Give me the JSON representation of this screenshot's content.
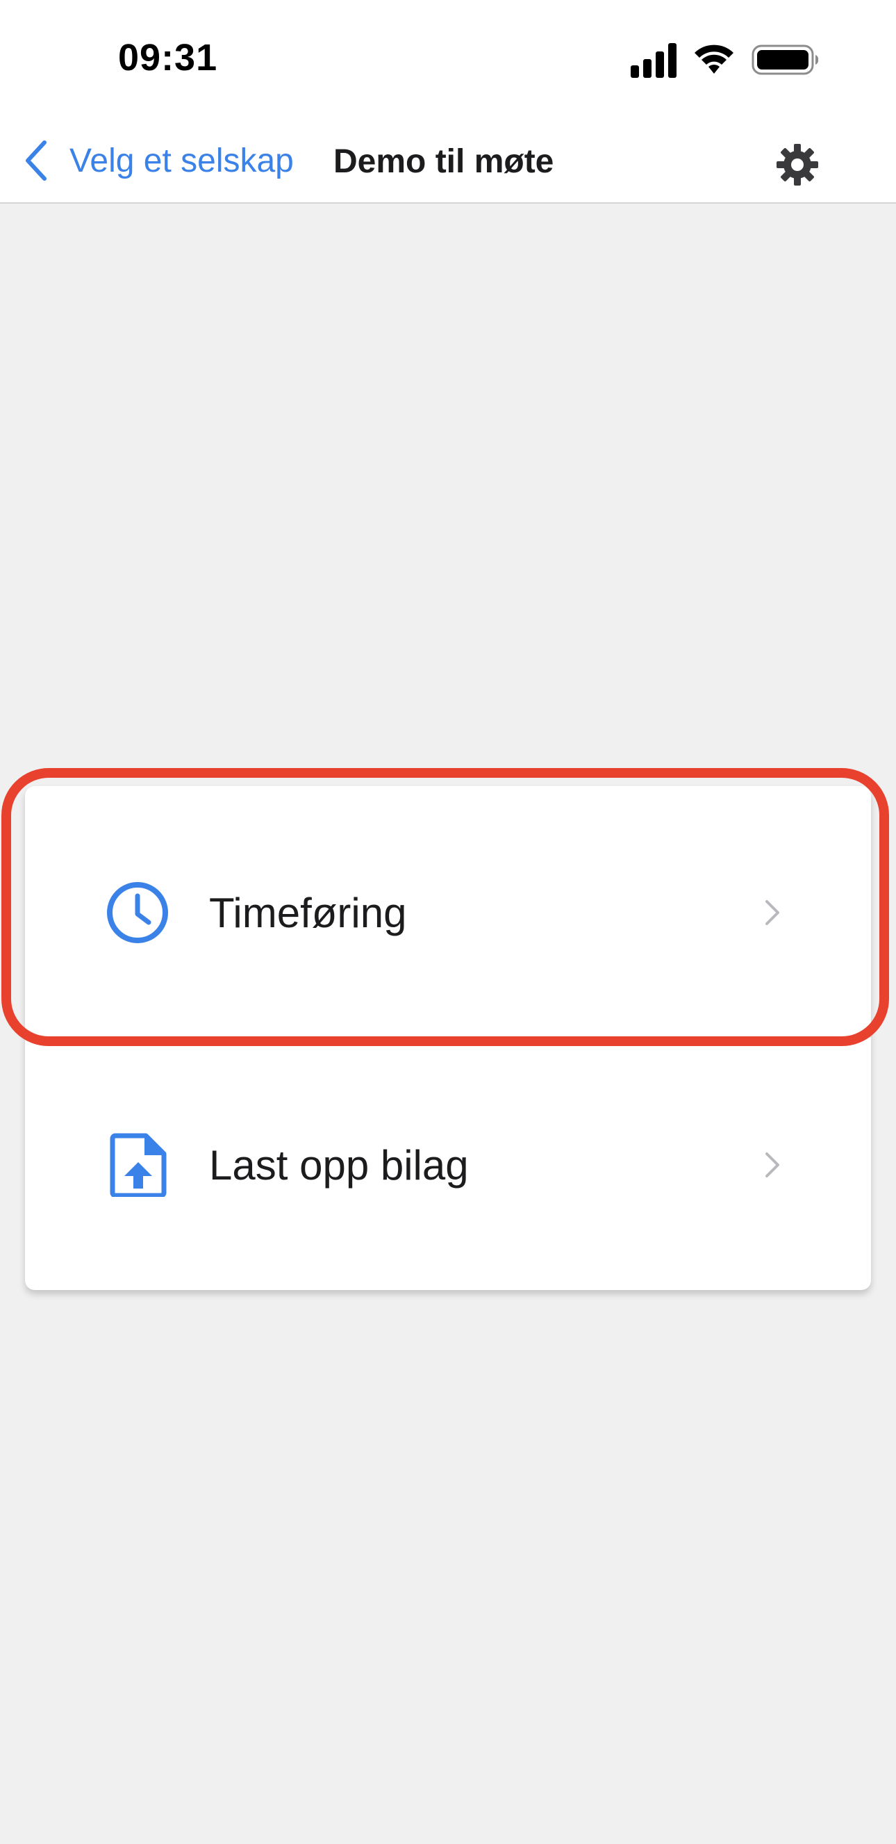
{
  "status_bar": {
    "time": "09:31",
    "icons": [
      "cellular-signal-icon",
      "wifi-icon",
      "battery-icon"
    ]
  },
  "nav": {
    "back_label": "Velg et selskap",
    "title": "Demo til møte",
    "settings_icon": "gear-icon"
  },
  "menu": {
    "items": [
      {
        "label": "Timeføring",
        "icon": "clock-icon",
        "highlighted": true
      },
      {
        "label": "Last opp bilag",
        "icon": "file-upload-icon",
        "highlighted": false
      }
    ]
  },
  "colors": {
    "accent": "#3b82e8",
    "highlight": "#e8412d",
    "background": "#f0f0f0",
    "card": "#ffffff",
    "text": "#1c1c1e",
    "chevron": "#b9b9bd"
  }
}
